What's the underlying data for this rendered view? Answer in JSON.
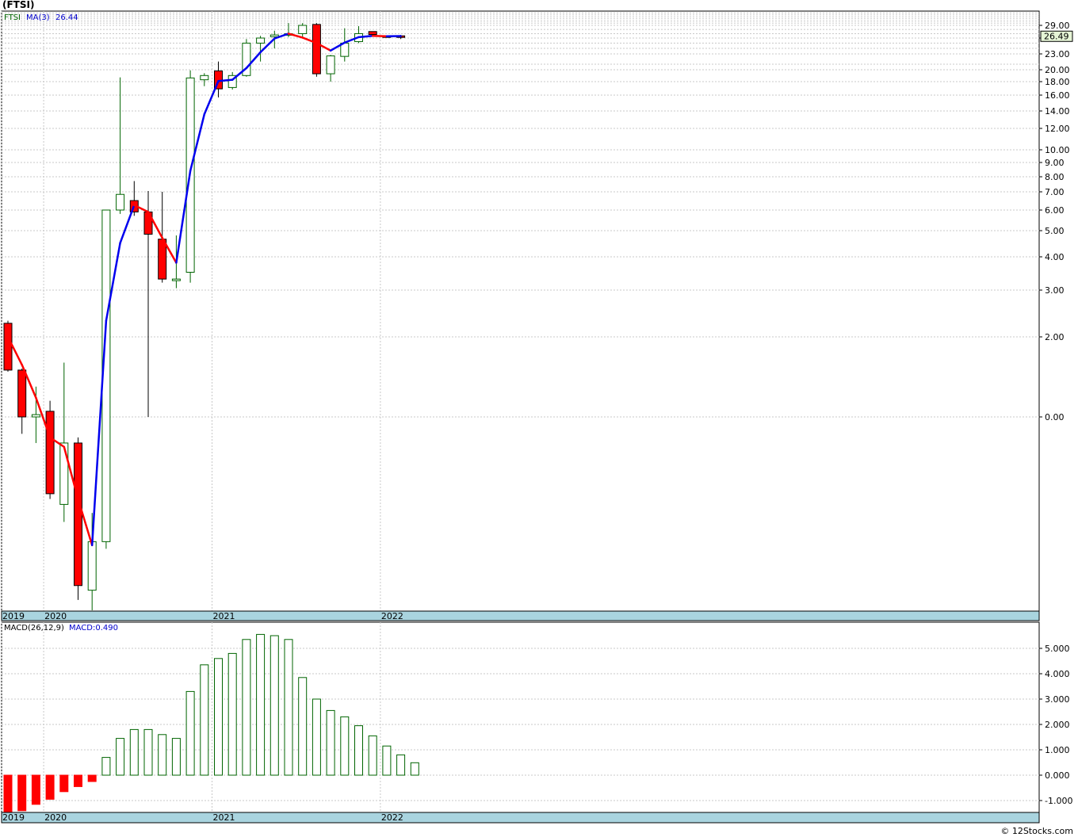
{
  "page_title": "(FTSI)",
  "credit": "© 12Stocks.com",
  "colors": {
    "up": "#006400",
    "down": "#ff0000",
    "ma_up": "#0000ee",
    "ma_down": "#ff0000",
    "axis_band": "#a9d4df",
    "last_box": "#e6f5d6",
    "grid": "#c8c8c8"
  },
  "chart_data": [
    {
      "type": "candlestick",
      "title": "",
      "legend": {
        "symbol": "FTSI",
        "ma_label": "MA(3)",
        "ma_value": "26.44"
      },
      "last_price_label": "26.49",
      "y_scale": "log",
      "ylim": [
        0.3,
        36
      ],
      "y_ticks": [
        0.0,
        2.0,
        3.0,
        4.0,
        5.0,
        6.0,
        7.0,
        8.0,
        9.0,
        10.0,
        12.0,
        14.0,
        16.0,
        18.0,
        20.0,
        23.0,
        26.0,
        29.0
      ],
      "x_labels": [
        {
          "label": "2019",
          "index": 0
        },
        {
          "label": "2020",
          "index": 3
        },
        {
          "label": "2021",
          "index": 15
        },
        {
          "label": "2022",
          "index": 27
        }
      ],
      "candles": [
        {
          "t": "2019-10",
          "o": 2.25,
          "h": 2.3,
          "l": 1.48,
          "c": 1.5
        },
        {
          "t": "2019-11",
          "o": 1.5,
          "h": 1.52,
          "l": 0.9,
          "c": 1.0
        },
        {
          "t": "2019-12",
          "o": 1.0,
          "h": 1.3,
          "l": 0.85,
          "c": 1.02
        },
        {
          "t": "2020-01",
          "o": 1.05,
          "h": 1.15,
          "l": 0.6,
          "c": 0.62
        },
        {
          "t": "2020-02",
          "o": 0.58,
          "h": 1.6,
          "l": 0.52,
          "c": 0.85
        },
        {
          "t": "2020-03",
          "o": 0.85,
          "h": 0.88,
          "l": 0.32,
          "c": 0.35
        },
        {
          "t": "2020-04",
          "o": 0.34,
          "h": 0.55,
          "l": 0.3,
          "c": 0.46
        },
        {
          "t": "2020-05",
          "o": 0.46,
          "h": 6.0,
          "l": 0.44,
          "c": 6.0
        },
        {
          "t": "2020-06",
          "o": 6.0,
          "h": 18.7,
          "l": 5.8,
          "c": 6.85
        },
        {
          "t": "2020-07",
          "o": 6.5,
          "h": 7.7,
          "l": 5.7,
          "c": 5.9
        },
        {
          "t": "2020-08",
          "o": 5.9,
          "h": 7.05,
          "l": 1.0,
          "c": 4.85
        },
        {
          "t": "2020-09",
          "o": 4.65,
          "h": 7.0,
          "l": 3.2,
          "c": 3.3
        },
        {
          "t": "2020-10",
          "o": 3.3,
          "h": 4.8,
          "l": 3.05,
          "c": 3.3
        },
        {
          "t": "2020-11",
          "o": 3.5,
          "h": 19.9,
          "l": 3.2,
          "c": 18.6
        },
        {
          "t": "2020-12",
          "o": 18.3,
          "h": 19.4,
          "l": 17.3,
          "c": 19.0
        },
        {
          "t": "2021-01",
          "o": 19.8,
          "h": 21.5,
          "l": 15.7,
          "c": 16.9
        },
        {
          "t": "2021-02",
          "o": 17.1,
          "h": 19.6,
          "l": 16.8,
          "c": 19.0
        },
        {
          "t": "2021-03",
          "o": 19.0,
          "h": 25.8,
          "l": 18.8,
          "c": 25.0
        },
        {
          "t": "2021-04",
          "o": 25.0,
          "h": 26.5,
          "l": 21.5,
          "c": 26.0
        },
        {
          "t": "2021-05",
          "o": 26.3,
          "h": 27.7,
          "l": 24.0,
          "c": 26.7
        },
        {
          "t": "2021-06",
          "o": 26.7,
          "h": 30.0,
          "l": 26.2,
          "c": 27.0
        },
        {
          "t": "2021-07",
          "o": 27.0,
          "h": 30.0,
          "l": 26.0,
          "c": 29.0
        },
        {
          "t": "2021-08",
          "o": 29.4,
          "h": 30.0,
          "l": 18.8,
          "c": 19.3
        },
        {
          "t": "2021-09",
          "o": 19.3,
          "h": 22.8,
          "l": 18.0,
          "c": 22.6
        },
        {
          "t": "2021-10",
          "o": 22.5,
          "h": 28.3,
          "l": 21.5,
          "c": 25.0
        },
        {
          "t": "2021-11",
          "o": 25.3,
          "h": 28.8,
          "l": 25.0,
          "c": 27.0
        },
        {
          "t": "2021-12",
          "o": 27.5,
          "h": 27.5,
          "l": 26.3,
          "c": 26.8
        },
        {
          "t": "2022-01",
          "o": 26.5,
          "h": 26.6,
          "l": 26.3,
          "c": 26.45
        },
        {
          "t": "2022-02",
          "o": 26.5,
          "h": 26.7,
          "l": 25.8,
          "c": 26.49
        }
      ],
      "ma": [
        {
          "index": 0,
          "v": 2.0
        },
        {
          "index": 1,
          "v": 1.57
        },
        {
          "index": 2,
          "v": 1.18
        },
        {
          "index": 3,
          "v": 0.88
        },
        {
          "index": 4,
          "v": 0.83
        },
        {
          "index": 5,
          "v": 0.6
        },
        {
          "index": 6,
          "v": 0.45
        },
        {
          "index": 7,
          "v": 2.3
        },
        {
          "index": 8,
          "v": 4.5
        },
        {
          "index": 9,
          "v": 6.25
        },
        {
          "index": 10,
          "v": 5.9
        },
        {
          "index": 11,
          "v": 4.7
        },
        {
          "index": 12,
          "v": 3.8
        },
        {
          "index": 13,
          "v": 8.4
        },
        {
          "index": 14,
          "v": 13.6
        },
        {
          "index": 15,
          "v": 18.1
        },
        {
          "index": 16,
          "v": 18.3
        },
        {
          "index": 17,
          "v": 20.3
        },
        {
          "index": 18,
          "v": 23.3
        },
        {
          "index": 19,
          "v": 25.9
        },
        {
          "index": 20,
          "v": 27.0
        },
        {
          "index": 21,
          "v": 26.1
        },
        {
          "index": 22,
          "v": 25.0
        },
        {
          "index": 23,
          "v": 23.6
        },
        {
          "index": 24,
          "v": 25.1
        },
        {
          "index": 25,
          "v": 26.2
        },
        {
          "index": 26,
          "v": 26.5
        },
        {
          "index": 27,
          "v": 26.4
        },
        {
          "index": 28,
          "v": 26.44
        }
      ]
    },
    {
      "type": "bar",
      "title": "",
      "legend": {
        "label": "MACD(26,12,9)",
        "value_label": "MACD:0.490"
      },
      "ylim": [
        -1.5,
        5.8
      ],
      "y_ticks": [
        -1.0,
        0.0,
        1.0,
        2.0,
        3.0,
        4.0,
        5.0
      ],
      "x_labels": [
        {
          "label": "2019",
          "index": 0
        },
        {
          "label": "2020",
          "index": 3
        },
        {
          "label": "2021",
          "index": 15
        },
        {
          "label": "2022",
          "index": 27
        }
      ],
      "values": [
        -1.5,
        -1.4,
        -1.15,
        -0.95,
        -0.65,
        -0.45,
        -0.25,
        0.7,
        1.45,
        1.8,
        1.8,
        1.6,
        1.45,
        3.3,
        4.35,
        4.6,
        4.8,
        5.35,
        5.55,
        5.5,
        5.35,
        3.85,
        3.0,
        2.55,
        2.3,
        1.95,
        1.55,
        1.15,
        0.8,
        0.49
      ]
    }
  ]
}
